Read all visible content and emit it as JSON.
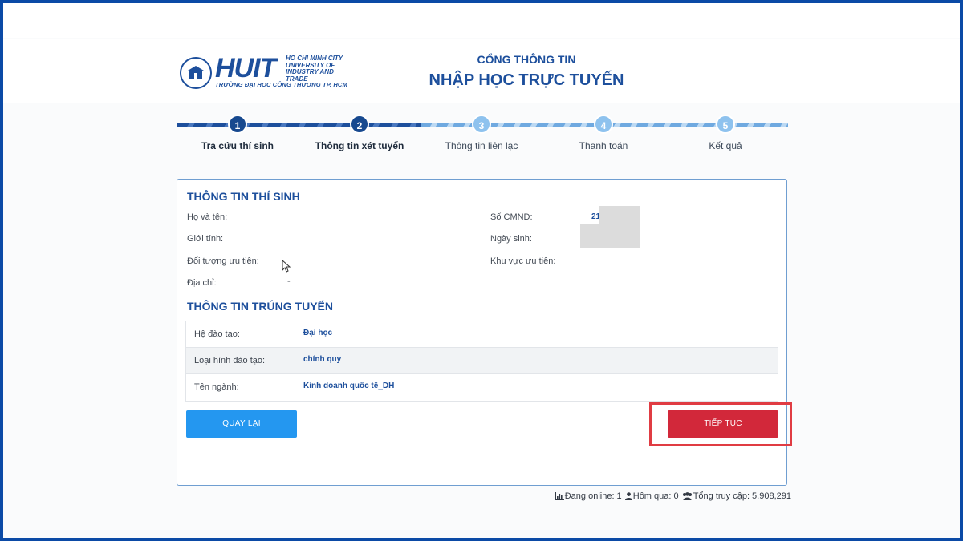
{
  "logo": {
    "brand": "HUIT",
    "city_line1": "HO CHI MINH CITY",
    "city_line2": "UNIVERSITY OF",
    "city_line3": "INDUSTRY AND TRADE",
    "subtitle": "TRƯỜNG ĐẠI HỌC CÔNG THƯƠNG TP. HCM"
  },
  "portal": {
    "line1": "CỔNG THÔNG TIN",
    "line2": "NHẬP HỌC TRỰC TUYẾN"
  },
  "steps": [
    {
      "number": "1",
      "label": "Tra cứu thí sinh",
      "state": "done"
    },
    {
      "number": "2",
      "label": "Thông tin xét tuyển",
      "state": "done"
    },
    {
      "number": "3",
      "label": "Thông tin liên lạc",
      "state": "todo"
    },
    {
      "number": "4",
      "label": "Thanh toán",
      "state": "todo"
    },
    {
      "number": "5",
      "label": "Kết quả",
      "state": "todo"
    }
  ],
  "candidate": {
    "title": "THÔNG TIN THÍ SINH",
    "name_label": "Họ và tên:",
    "gender_label": "Giới tính:",
    "priority_group_label": "Đối tượng ưu tiên:",
    "address_label": "Địa chỉ:",
    "address_value": "-",
    "id_label": "Số CMND:",
    "id_value": "21",
    "dob_label": "Ngày sinh:",
    "priority_area_label": "Khu vực ưu tiên:"
  },
  "admission": {
    "title": "THÔNG TIN TRÚNG TUYỂN",
    "rows": [
      {
        "label": "Hệ đào tạo:",
        "value": "Đại học"
      },
      {
        "label": "Loại hình đào tạo:",
        "value": "chính quy"
      },
      {
        "label": "Tên ngành:",
        "value": "Kinh doanh quốc tế_DH"
      }
    ]
  },
  "buttons": {
    "back": "QUAY LẠI",
    "next": "TIẾP TỤC"
  },
  "stats": {
    "online": "Đang online: 1",
    "yesterday": "Hôm qua: 0",
    "total": "Tổng truy cập: 5,908,291"
  },
  "colors": {
    "brand_blue": "#1d4f9c",
    "button_blue": "#2497f0",
    "button_red": "#d2283a",
    "highlight_red": "#e03c43"
  }
}
